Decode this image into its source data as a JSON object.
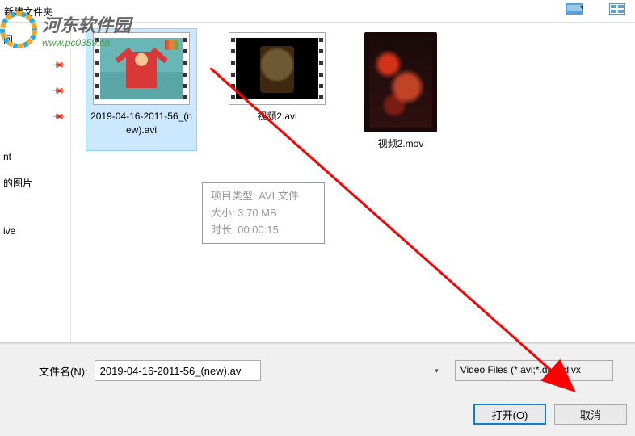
{
  "watermark": {
    "cn": "河东软件园",
    "url": "www.pc0359.cn"
  },
  "toolbar": {
    "folder_label": "新建文件夹"
  },
  "sidebar": {
    "items": [
      {
        "label": "问"
      },
      {
        "label": ""
      },
      {
        "label": ""
      },
      {
        "label": ""
      },
      {
        "label": "nt"
      },
      {
        "label": "的图片"
      },
      {
        "label": ""
      },
      {
        "label": "ive"
      }
    ]
  },
  "files": [
    {
      "label": "2019-04-16-2011-56_(new).avi",
      "selected": true
    },
    {
      "label": "视频2.avi",
      "selected": false
    },
    {
      "label": "视频2.mov",
      "selected": false
    }
  ],
  "tooltip": {
    "line1": "项目类型: AVI 文件",
    "line2": "大小: 3.70 MB",
    "line3": "时长: 00:00:15"
  },
  "footer": {
    "filename_label": "文件名(N):",
    "filename_value": "2019-04-16-2011-56_(new).avi",
    "filetype_label": "Video Files  (*.avi;*.div;*.divx",
    "open_btn": "打开(O)",
    "cancel_btn": "取消"
  }
}
